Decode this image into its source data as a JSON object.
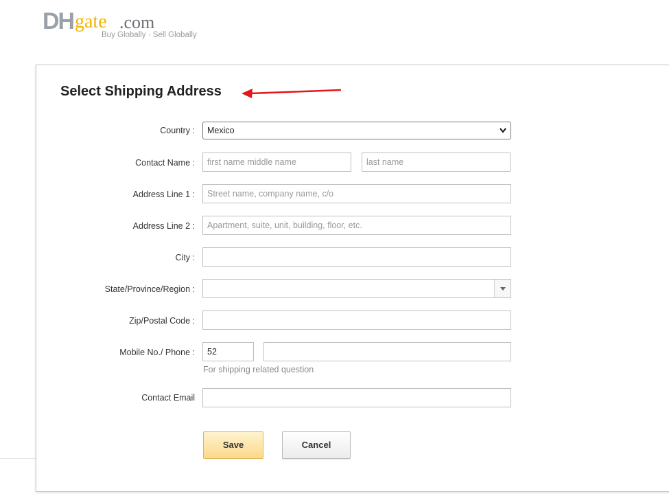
{
  "logo": {
    "brand_dh": "DH",
    "brand_gate": "gate",
    "brand_com": ".com",
    "tagline": "Buy Globally · Sell Globally"
  },
  "form": {
    "title": "Select Shipping Address",
    "country": {
      "label": "Country :",
      "value": "Mexico"
    },
    "contact_name": {
      "label": "Contact Name :",
      "first_placeholder": "first name middle name",
      "last_placeholder": "last name"
    },
    "address1": {
      "label": "Address Line 1 :",
      "placeholder": "Street name, company name, c/o"
    },
    "address2": {
      "label": "Address Line 2 :",
      "placeholder": "Apartment, suite, unit, building, floor, etc."
    },
    "city": {
      "label": "City :",
      "value": ""
    },
    "state": {
      "label": "State/Province/Region :",
      "value": ""
    },
    "zip": {
      "label": "Zip/Postal Code :",
      "value": ""
    },
    "phone": {
      "label": "Mobile No./ Phone :",
      "code": "52",
      "number": "",
      "hint": "For shipping related question"
    },
    "email": {
      "label": "Contact Email",
      "value": ""
    },
    "save_label": "Save",
    "cancel_label": "Cancel"
  },
  "colors": {
    "annotation_arrow": "#e3161b",
    "save_button": "#fbd98a",
    "logo_gate": "#f0b400"
  }
}
